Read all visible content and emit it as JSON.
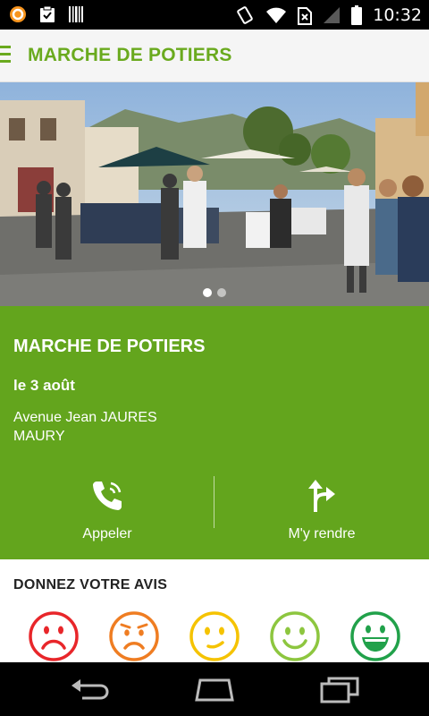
{
  "status_bar": {
    "time": "10:32",
    "left_icons": [
      "app-notification-icon",
      "clipboard-check-icon",
      "barcode-icon"
    ],
    "right_icons": [
      "vibrate-icon",
      "wifi-icon",
      "no-sim-icon",
      "signal-icon",
      "battery-icon"
    ]
  },
  "app_bar": {
    "title": "MARCHE DE POTIERS"
  },
  "carousel": {
    "page_count": 2,
    "active_index": 0
  },
  "event": {
    "title": "MARCHE DE POTIERS",
    "date": "le 3 août",
    "address_line1": "Avenue Jean JAURES",
    "address_line2": "MAURY"
  },
  "actions": {
    "call_label": "Appeler",
    "directions_label": "M'y rendre"
  },
  "review": {
    "title": "DONNEZ VOTRE AVIS",
    "ratings": [
      {
        "name": "very-unhappy-face-icon",
        "color": "#e8262a"
      },
      {
        "name": "unhappy-face-icon",
        "color": "#ef7d22"
      },
      {
        "name": "neutral-face-icon",
        "color": "#f5c300"
      },
      {
        "name": "happy-face-icon",
        "color": "#8dc63f"
      },
      {
        "name": "very-happy-face-icon",
        "color": "#21a14a"
      }
    ]
  },
  "colors": {
    "accent_green": "#6aaa1e",
    "panel_green": "#63a51d"
  }
}
